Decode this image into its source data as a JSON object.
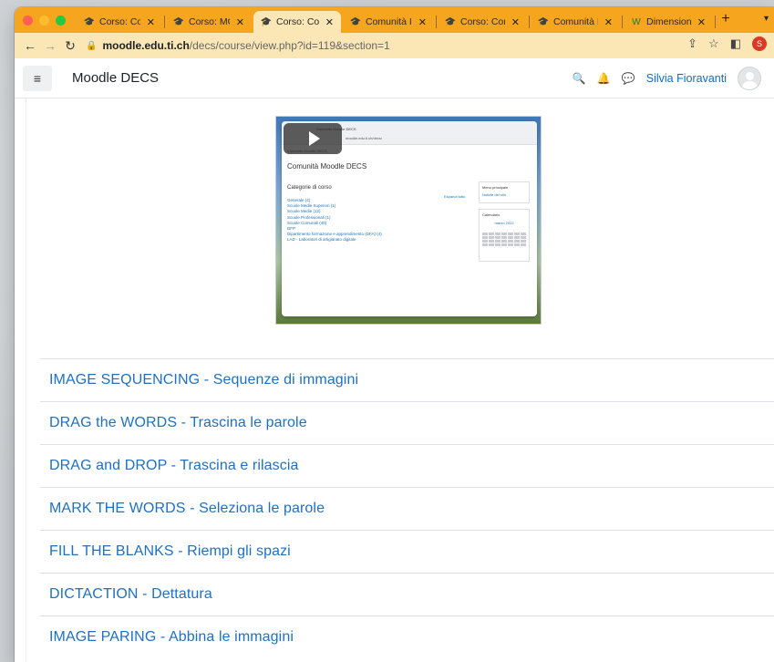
{
  "browser": {
    "tabs": [
      {
        "label": "Corso: Comu",
        "active": false
      },
      {
        "label": "Corso: MOOD",
        "active": false
      },
      {
        "label": "Corso: Comu",
        "active": true
      },
      {
        "label": "Comunità IRI",
        "active": false
      },
      {
        "label": "Corso: Comu",
        "active": false
      },
      {
        "label": "Comunità IRI",
        "active": false
      },
      {
        "label": "Dimensioni ta",
        "active": false
      }
    ],
    "url_host": "moodle.edu.ti.ch",
    "url_path": "/decs/course/view.php?id=119&section=1",
    "profile_initial": "S"
  },
  "header": {
    "site_name": "Moodle DECS",
    "user_name": "Silvia Fioravanti"
  },
  "video_preview": {
    "tab_title": "Comunità Moodle DECS",
    "url": "moodle.edu.ti.ch/decs/",
    "breadcrumb": "Comunità Moodle DECS",
    "site_title": "Comunità Moodle DECS",
    "categories_title": "Categorie di corso",
    "expand_all": "Espandi tutto",
    "categories": [
      "Generale (4)",
      "Scuole Medie Superiori (1)",
      "Scuole Medie (12)",
      "Scuole Professionali (1)",
      "Scuole Comunali (40)",
      "DFP",
      "Dipartimento formazione e apprendimento (DFA) (4)",
      "LAD - Laboratori di artigianato digitale"
    ],
    "side_block_title": "Menu principale",
    "side_block_item": "Notizie del sito",
    "calendar_title": "Calendario",
    "calendar_month": "marzo 2022"
  },
  "activities": [
    "IMAGE SEQUENCING - Sequenze di immagini",
    "DRAG the WORDS - Trascina le parole",
    "DRAG and DROP - Trascina e rilascia",
    "MARK THE WORDS - Seleziona le parole",
    "FILL THE BLANKS - Riempi gli spazi",
    "DICTACTION - Dettatura",
    "IMAGE PARING - Abbina le immagini"
  ],
  "colors": {
    "tab_strip": "#f5a51e",
    "toolbar": "#fbe7b6",
    "link": "#1f70c1",
    "user_link": "#0f6cbf"
  }
}
